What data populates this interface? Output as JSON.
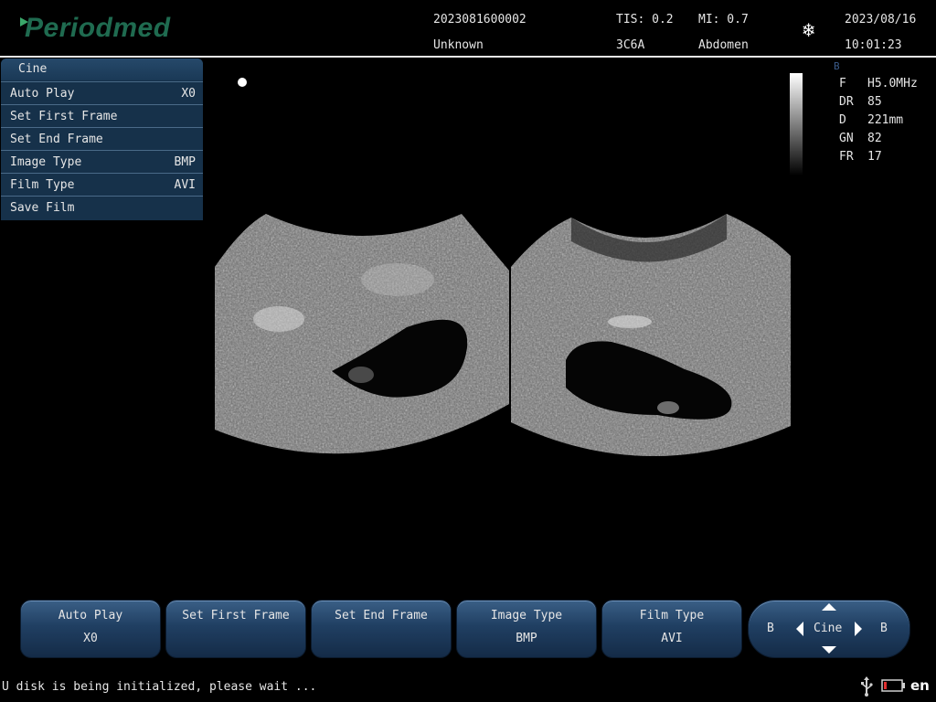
{
  "brand": "Periodmed",
  "header": {
    "patient_id": "2023081600002",
    "patient_name": "Unknown",
    "tis": "TIS: 0.2",
    "mi": "MI: 0.7",
    "probe": "3C6A",
    "exam": "Abdomen",
    "date": "2023/08/16",
    "time": "10:01:23",
    "freeze_icon": "snowflake-icon"
  },
  "menu": {
    "title": "Cine",
    "items": [
      {
        "label": "Auto Play",
        "value": "X0"
      },
      {
        "label": "Set First Frame",
        "value": ""
      },
      {
        "label": "Set End Frame",
        "value": ""
      },
      {
        "label": "Image Type",
        "value": "BMP"
      },
      {
        "label": "Film Type",
        "value": "AVI"
      },
      {
        "label": "Save Film",
        "value": ""
      }
    ]
  },
  "params": {
    "mode": "B",
    "rows": [
      {
        "key": "F",
        "value": "H5.0MHz"
      },
      {
        "key": "DR",
        "value": "85"
      },
      {
        "key": "D",
        "value": "221mm"
      },
      {
        "key": "GN",
        "value": "82"
      },
      {
        "key": "FR",
        "value": "17"
      }
    ]
  },
  "bottom": {
    "buttons": [
      {
        "label": "Auto Play",
        "value": "X0"
      },
      {
        "label": "Set First Frame",
        "value": ""
      },
      {
        "label": "Set End Frame",
        "value": ""
      },
      {
        "label": "Image Type",
        "value": "BMP"
      },
      {
        "label": "Film Type",
        "value": "AVI"
      }
    ],
    "cine": {
      "left": "B",
      "center": "Cine",
      "right": "B"
    }
  },
  "status": {
    "message": "U disk is being initialized, please wait ...",
    "usb_icon": "usb-icon",
    "battery_icon": "battery-low-icon",
    "language": "en"
  },
  "colors": {
    "menu_bg": "#16314a",
    "button_top": "#3a5f86",
    "brand": "#1f6b50"
  }
}
